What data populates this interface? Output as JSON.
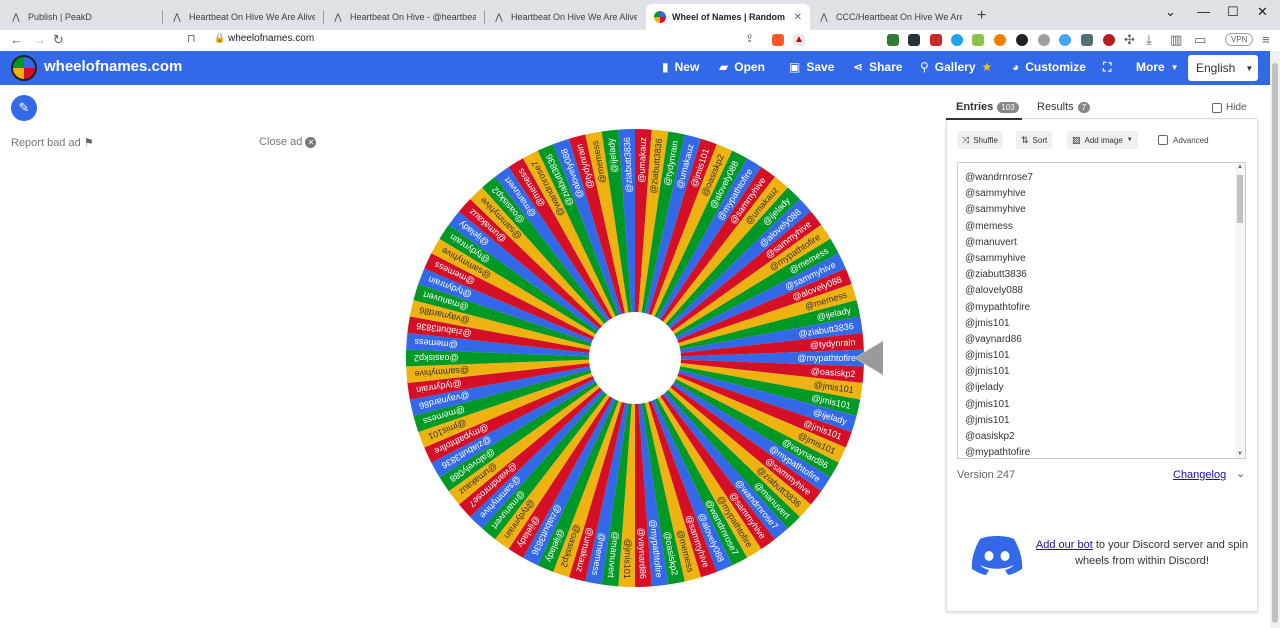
{
  "browser": {
    "tabs": [
      {
        "title": "Publish | PeakD",
        "active": false,
        "closable": false
      },
      {
        "title": "Heartbeat On Hive We Are Alive Tribe",
        "active": false,
        "closable": false
      },
      {
        "title": "Heartbeat On Hive - @heartbeatonhive",
        "active": false,
        "closable": false
      },
      {
        "title": "Heartbeat On Hive We Are Alive Tribe",
        "active": false,
        "closable": false
      },
      {
        "title": "Wheel of Names | Random name",
        "active": true,
        "closable": true
      },
      {
        "title": "CCC/Heartbeat On Hive We Are Alive",
        "active": false,
        "closable": false
      }
    ],
    "url": "wheelofnames.com",
    "vpn_label": "VPN"
  },
  "header": {
    "brand": "wheelofnames.com",
    "buttons": {
      "new": "New",
      "open": "Open",
      "save": "Save",
      "share": "Share",
      "gallery": "Gallery",
      "customize": "Customize",
      "more": "More"
    },
    "language": "English"
  },
  "left": {
    "report_ad": "Report bad ad",
    "close_ad": "Close ad"
  },
  "wheel": {
    "colors": [
      "#3369e8",
      "#d50f25",
      "#eeb211",
      "#009925"
    ],
    "labels": [
      "@mypathtofire",
      "@oasiskp2",
      "@jmis101",
      "@jmis101",
      "@ijelady",
      "@jmis101",
      "@jmis101",
      "@vaynard86",
      "@mypathtofire",
      "@sammyhive",
      "@ziabutt3836",
      "@manuvert",
      "@wandrnrose7",
      "@sammyhive",
      "@mypathtofire",
      "@wandrnrose7",
      "@alovely088",
      "@sammyhive",
      "@memess",
      "@oasiskp2",
      "@mypathtofire",
      "@vaynard86",
      "@jmis101",
      "@manuvert",
      "@memess",
      "@umakauz",
      "@oasiskp2",
      "@ijelady",
      "@ziabutt3836",
      "@ijelady",
      "@tydynrain",
      "@manuvert",
      "@sammyhive",
      "@wandrnrose7",
      "@umakauz",
      "@alovely088",
      "@ziabutt3836",
      "@mypathtofire",
      "@jmis101",
      "@memess",
      "@vaynard86",
      "@tydynrain",
      "@sammyhive",
      "@oasiskp2",
      "@memess",
      "@ziabutt3836",
      "@vaynard86",
      "@manuvert",
      "@tydynrain",
      "@memess",
      "@sammyhive",
      "@tydynrain",
      "@ijelady",
      "@umakauz",
      "@sammyhive",
      "@oasiskp2",
      "@manuvert",
      "@memess",
      "@wandrnrose7",
      "@ziabutt3836",
      "@alovely088",
      "@tydynrain",
      "@memess",
      "@ijelady",
      "@ziabutt3836",
      "@umakauz",
      "@ziabutt3836",
      "@tydynrain",
      "@umakauz",
      "@jmis101",
      "@oasiskp2",
      "@alovely088",
      "@mypathtofire",
      "@sammyhive",
      "@umakauz",
      "@ijelady",
      "@alovely088",
      "@sammyhive",
      "@mypathtofire",
      "@memess",
      "@sammyhive",
      "@alovely088",
      "@memess",
      "@ijelady",
      "@ziabutt3836",
      "@tydynrain"
    ]
  },
  "panel": {
    "tab_entries": "Entries",
    "entries_count": "103",
    "tab_results": "Results",
    "results_count": "7",
    "hide_label": "Hide",
    "shuffle": "Shuffle",
    "sort": "Sort",
    "add_image": "Add image",
    "advanced": "Advanced",
    "entries": [
      "@wandrnrose7",
      "@sammyhive",
      "@sammyhive",
      "@memess",
      "@manuvert",
      "@sammyhive",
      "@ziabutt3836",
      "@alovely088",
      "@mypathtofire",
      "@jmis101",
      "@vaynard86",
      "@jmis101",
      "@jmis101",
      "@ijelady",
      "@jmis101",
      "@jmis101",
      "@oasiskp2",
      "@mypathtofire"
    ],
    "version": "Version 247",
    "changelog": "Changelog",
    "discord_link": "Add our bot",
    "discord_text": "to your Discord server and spin wheels from within Discord!"
  }
}
